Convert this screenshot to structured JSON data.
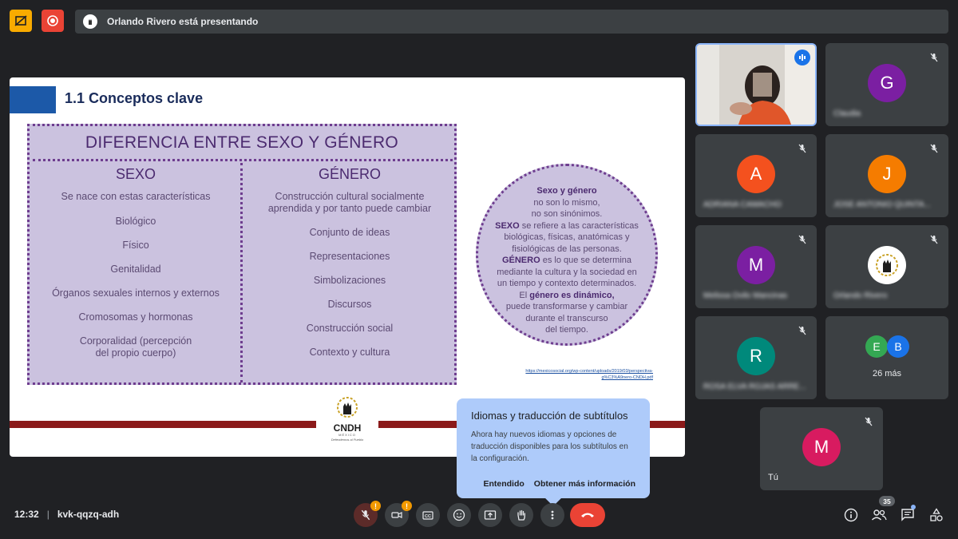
{
  "topbar": {
    "presenting_text": "Orlando Rivero está presentando"
  },
  "slide": {
    "title": "1.1  Conceptos clave",
    "diff_title": "DIFERENCIA ENTRE SEXO Y GÉNERO",
    "col_sexo": {
      "head": "SEXO",
      "items": [
        "Se nace con estas características",
        "Biológico",
        "Físico",
        "Genitalidad",
        "Órganos sexuales internos y externos",
        "Cromosomas y hormonas",
        "Corporalidad (percepción\ndel propio cuerpo)"
      ]
    },
    "col_genero": {
      "head": "GÉNERO",
      "items": [
        "Construcción cultural socialmente\naprendida y por tanto puede cambiar",
        "Conjunto de ideas",
        "Representaciones",
        "Simbolizaciones",
        "Discursos",
        "Construcción social",
        "Contexto y cultura"
      ]
    },
    "circle": {
      "l1": "Sexo y género",
      "l2": "no son lo mismo,",
      "l3": "no son sinónimos.",
      "l4a": "SEXO",
      "l4b": " se refiere a las características",
      "l5": "biológicas, físicas, anatómicas y",
      "l6": "fisiológicas de las personas.",
      "l7a": "GÉNERO",
      "l7b": " es lo que se determina",
      "l8": "mediante la cultura y la sociedad en",
      "l9": "un tiempo y contexto determinados.",
      "l10a": "El ",
      "l10b": "género es dinámico,",
      "l11": "puede transformarse y cambiar",
      "l12": "durante el transcurso",
      "l13": "del tiempo."
    },
    "source_link_1": "https://mexicosocial.org/wp-content/uploads/2019/03/perspectiva-",
    "source_link_2": "g%C3%A9nero-CNDH.pdf",
    "logo_text": "CNDH",
    "logo_sub": "MÉXICO",
    "logo_motto": "Defendemos al Pueblo"
  },
  "tiles": [
    {
      "id": "t1",
      "name": "",
      "initial": ""
    },
    {
      "id": "t2",
      "name": "Claudia",
      "initial": "G",
      "color": "#7b1fa2"
    },
    {
      "id": "t3",
      "name": "ADRIANA CAMACHO",
      "initial": "A",
      "color": "#f4511e"
    },
    {
      "id": "t4",
      "name": "JOSE ANTONIO QUINTA...",
      "initial": "J",
      "color": "#f57c00"
    },
    {
      "id": "t5",
      "name": "Melissa Ovilo Mancinas",
      "initial": "M",
      "color": "#7b1fa2"
    },
    {
      "id": "t6",
      "name": "Orlando Rivero",
      "initial": ""
    },
    {
      "id": "t7",
      "name": "ROSA ELVA ROJAS ARRE...",
      "initial": "R",
      "color": "#00897b"
    },
    {
      "id": "t8",
      "name": "26 más",
      "e": "E",
      "b": "B",
      "e_color": "#34a853",
      "b_color": "#1a73e8"
    },
    {
      "id": "t9",
      "name": "Tú",
      "initial": "M",
      "color": "#d81b60"
    }
  ],
  "popover": {
    "title": "Idiomas y traducción de subtítulos",
    "body": "Ahora hay nuevos idiomas y opciones de traducción disponibles para los subtítulos en la configuración.",
    "got_it": "Entendido",
    "learn_more": "Obtener más información"
  },
  "bottombar": {
    "time": "12:32",
    "separator": "|",
    "meeting_code": "kvk-qqzq-adh",
    "badge_mic": "!",
    "badge_cam": "!",
    "people_count": "35"
  }
}
